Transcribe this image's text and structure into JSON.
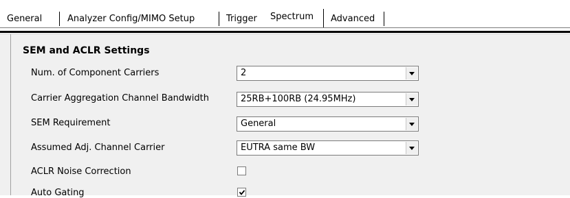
{
  "tabs": [
    {
      "label": "General",
      "active": false
    },
    {
      "label": "Analyzer Config/MIMO Setup",
      "active": false
    },
    {
      "label": "Trigger",
      "active": false
    },
    {
      "label": "Spectrum",
      "active": true
    },
    {
      "label": "Advanced",
      "active": false
    }
  ],
  "section": {
    "title": "SEM and ACLR Settings"
  },
  "fields": {
    "num_component_carriers": {
      "label": "Num. of Component Carriers",
      "value": "2"
    },
    "ca_channel_bandwidth": {
      "label": "Carrier Aggregation Channel Bandwidth",
      "value": "25RB+100RB (24.95MHz)"
    },
    "sem_requirement": {
      "label": "SEM Requirement",
      "value": "General"
    },
    "assumed_adj_channel_carrier": {
      "label": "Assumed Adj. Channel Carrier",
      "value": "EUTRA same BW"
    },
    "aclr_noise_correction": {
      "label": "ACLR Noise Correction",
      "checked": false
    },
    "auto_gating": {
      "label": "Auto Gating",
      "checked": true
    }
  },
  "icons": {
    "dropdown": "chevron-down-icon",
    "checkmark": "checkmark-icon"
  }
}
